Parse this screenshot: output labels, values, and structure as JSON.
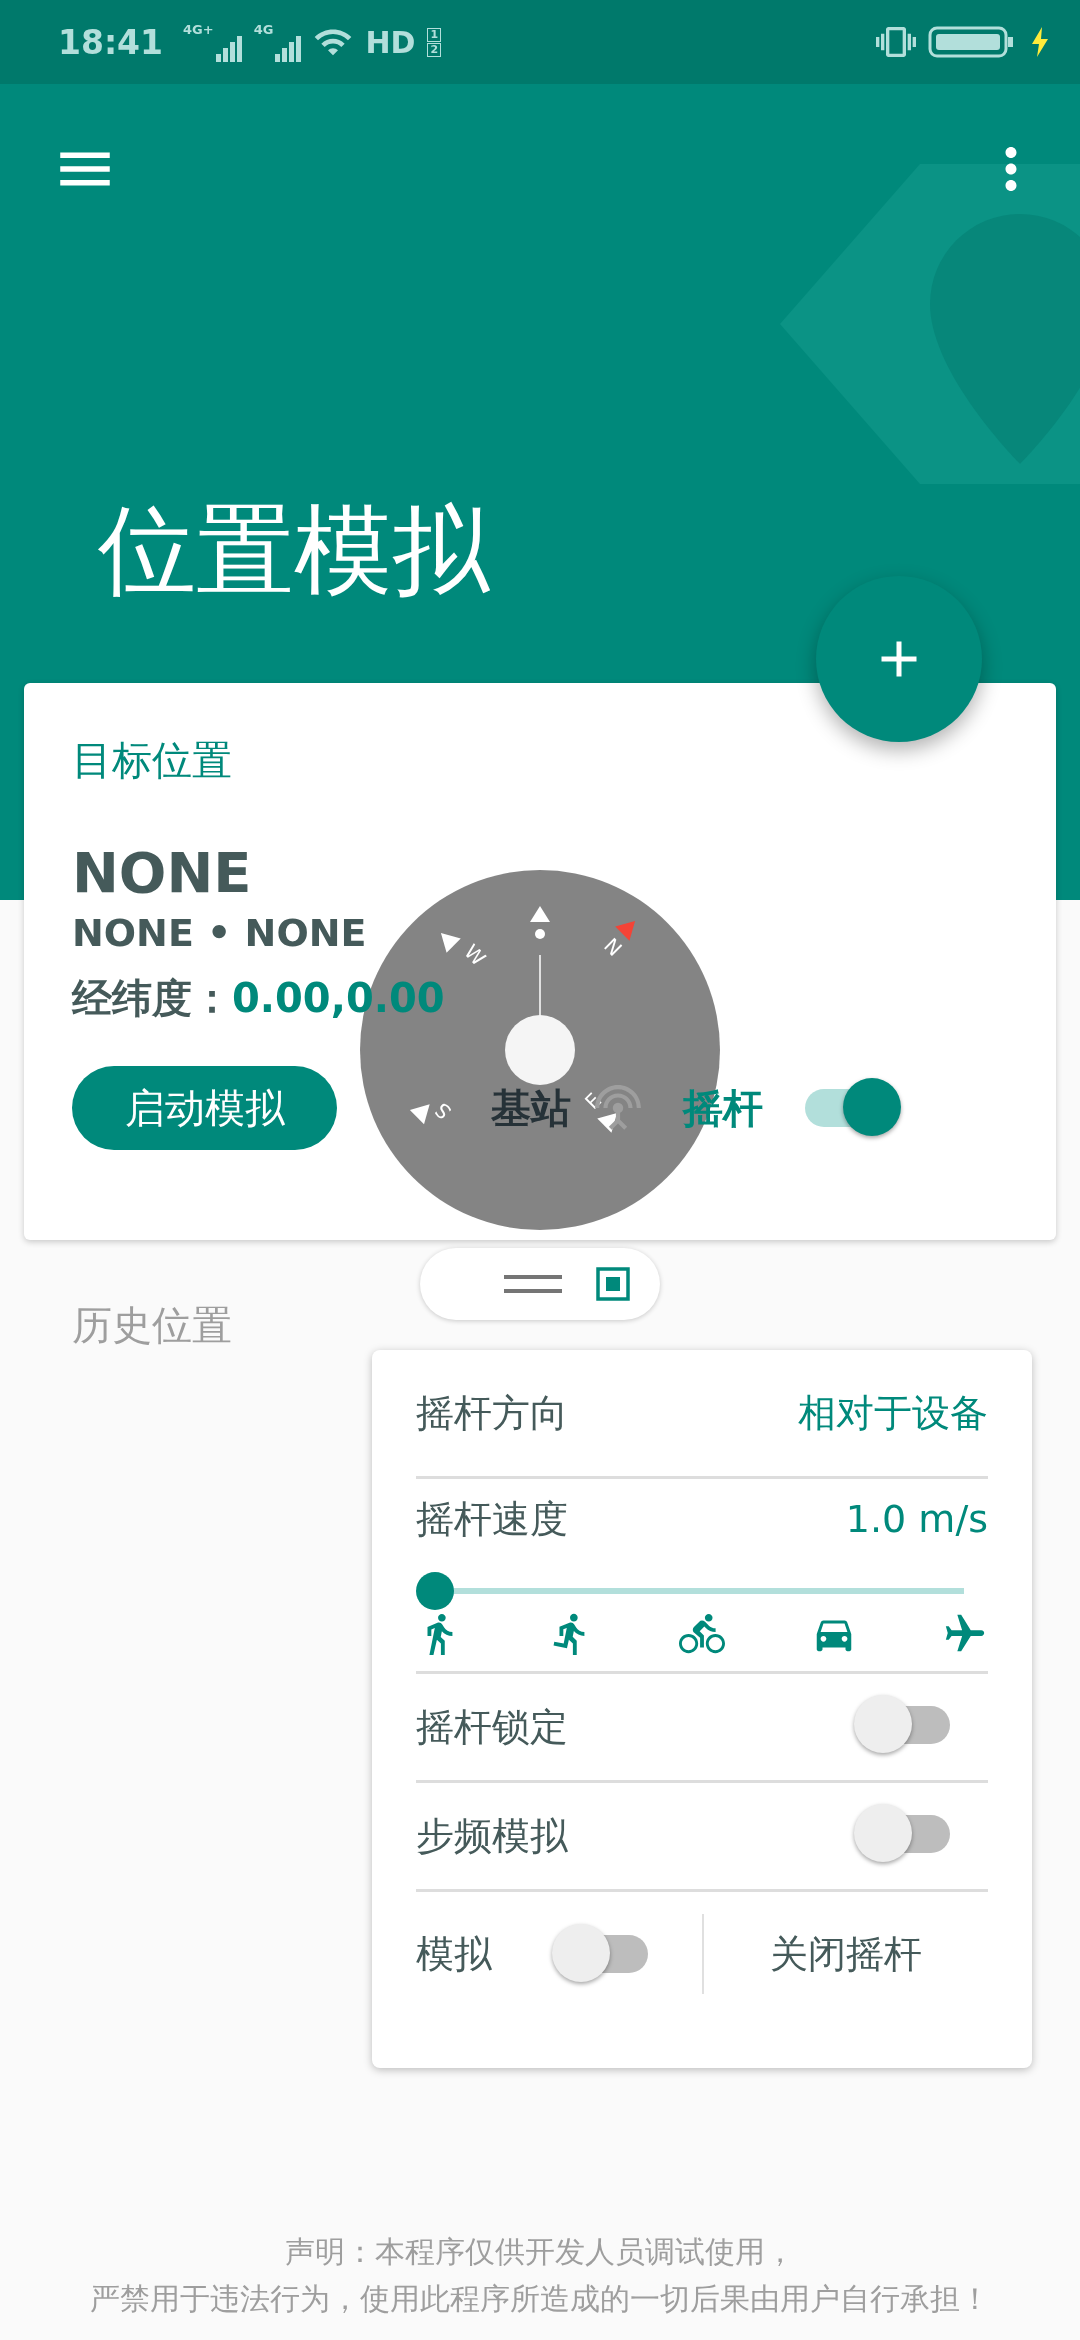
{
  "status_bar": {
    "time": "18:41",
    "network_1": "4G+",
    "network_2": "4G",
    "hd": "HD",
    "sim_1": "1",
    "sim_2": "2"
  },
  "title": "位置模拟",
  "card": {
    "heading": "目标位置",
    "name": "NONE",
    "subtitle": "NONE • NONE",
    "coords_label": "经纬度：",
    "coords_value": "0.00,0.00",
    "start_button": "启动模拟",
    "modes": [
      {
        "kind": "icon",
        "label": "基站",
        "active": false
      },
      {
        "kind": "switch",
        "label": "摇杆",
        "on": true
      }
    ]
  },
  "compass": {
    "north": "N",
    "east": "E",
    "south": "S",
    "west": "W"
  },
  "history_label": "历史位置",
  "joystick_panel": {
    "direction_label": "摇杆方向",
    "direction_value": "相对于设备",
    "speed_label": "摇杆速度",
    "speed_value": "1.0 m/s",
    "speed_slider": {
      "level": 0
    },
    "toggles": [
      {
        "label": "摇杆锁定",
        "on": false
      },
      {
        "label": "步频模拟",
        "on": false
      }
    ],
    "simulate": {
      "label": "模拟",
      "on": false
    },
    "close_button": "关闭摇杆"
  },
  "footer": [
    "声明：本程序仅供开发人员调试使用，",
    "严禁用于违法行为，使用此程序所造成的一切后果由用户自行承担！"
  ]
}
